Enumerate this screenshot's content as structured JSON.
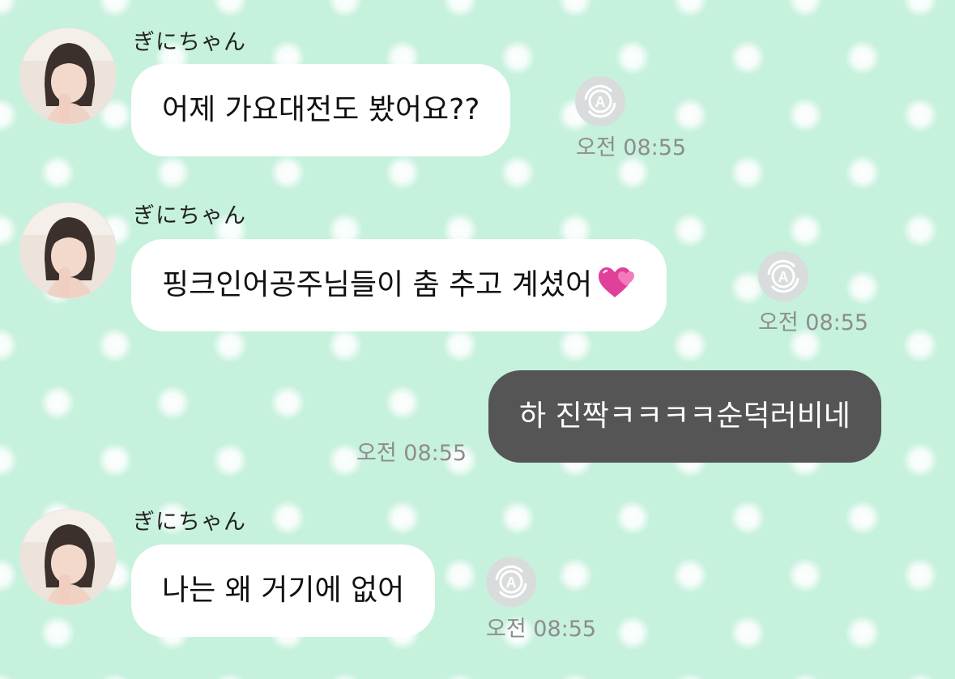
{
  "messages": [
    {
      "sender": "ぎにちゃん",
      "text": "어제 가요대전도 봤어요??",
      "time": "오전 08:55",
      "translate_icon": "auto-translate-icon"
    },
    {
      "sender": "ぎにちゃん",
      "text": "핑크인어공주님들이 춤 추고 계셨어",
      "emoji": "💞",
      "time": "오전 08:55",
      "translate_icon": "auto-translate-icon"
    },
    {
      "text": "하 진짝ㅋㅋㅋㅋ순덕러비네",
      "time": "오전 08:55",
      "outgoing": true
    },
    {
      "sender": "ぎにちゃん",
      "text": "나는 왜 거기에 없어",
      "time": "오전 08:55",
      "translate_icon": "auto-translate-icon"
    }
  ],
  "colors": {
    "background": "#c6f1dd",
    "incoming_bubble": "#ffffff",
    "outgoing_bubble": "#555555",
    "timestamp": "#8d8d8d"
  }
}
